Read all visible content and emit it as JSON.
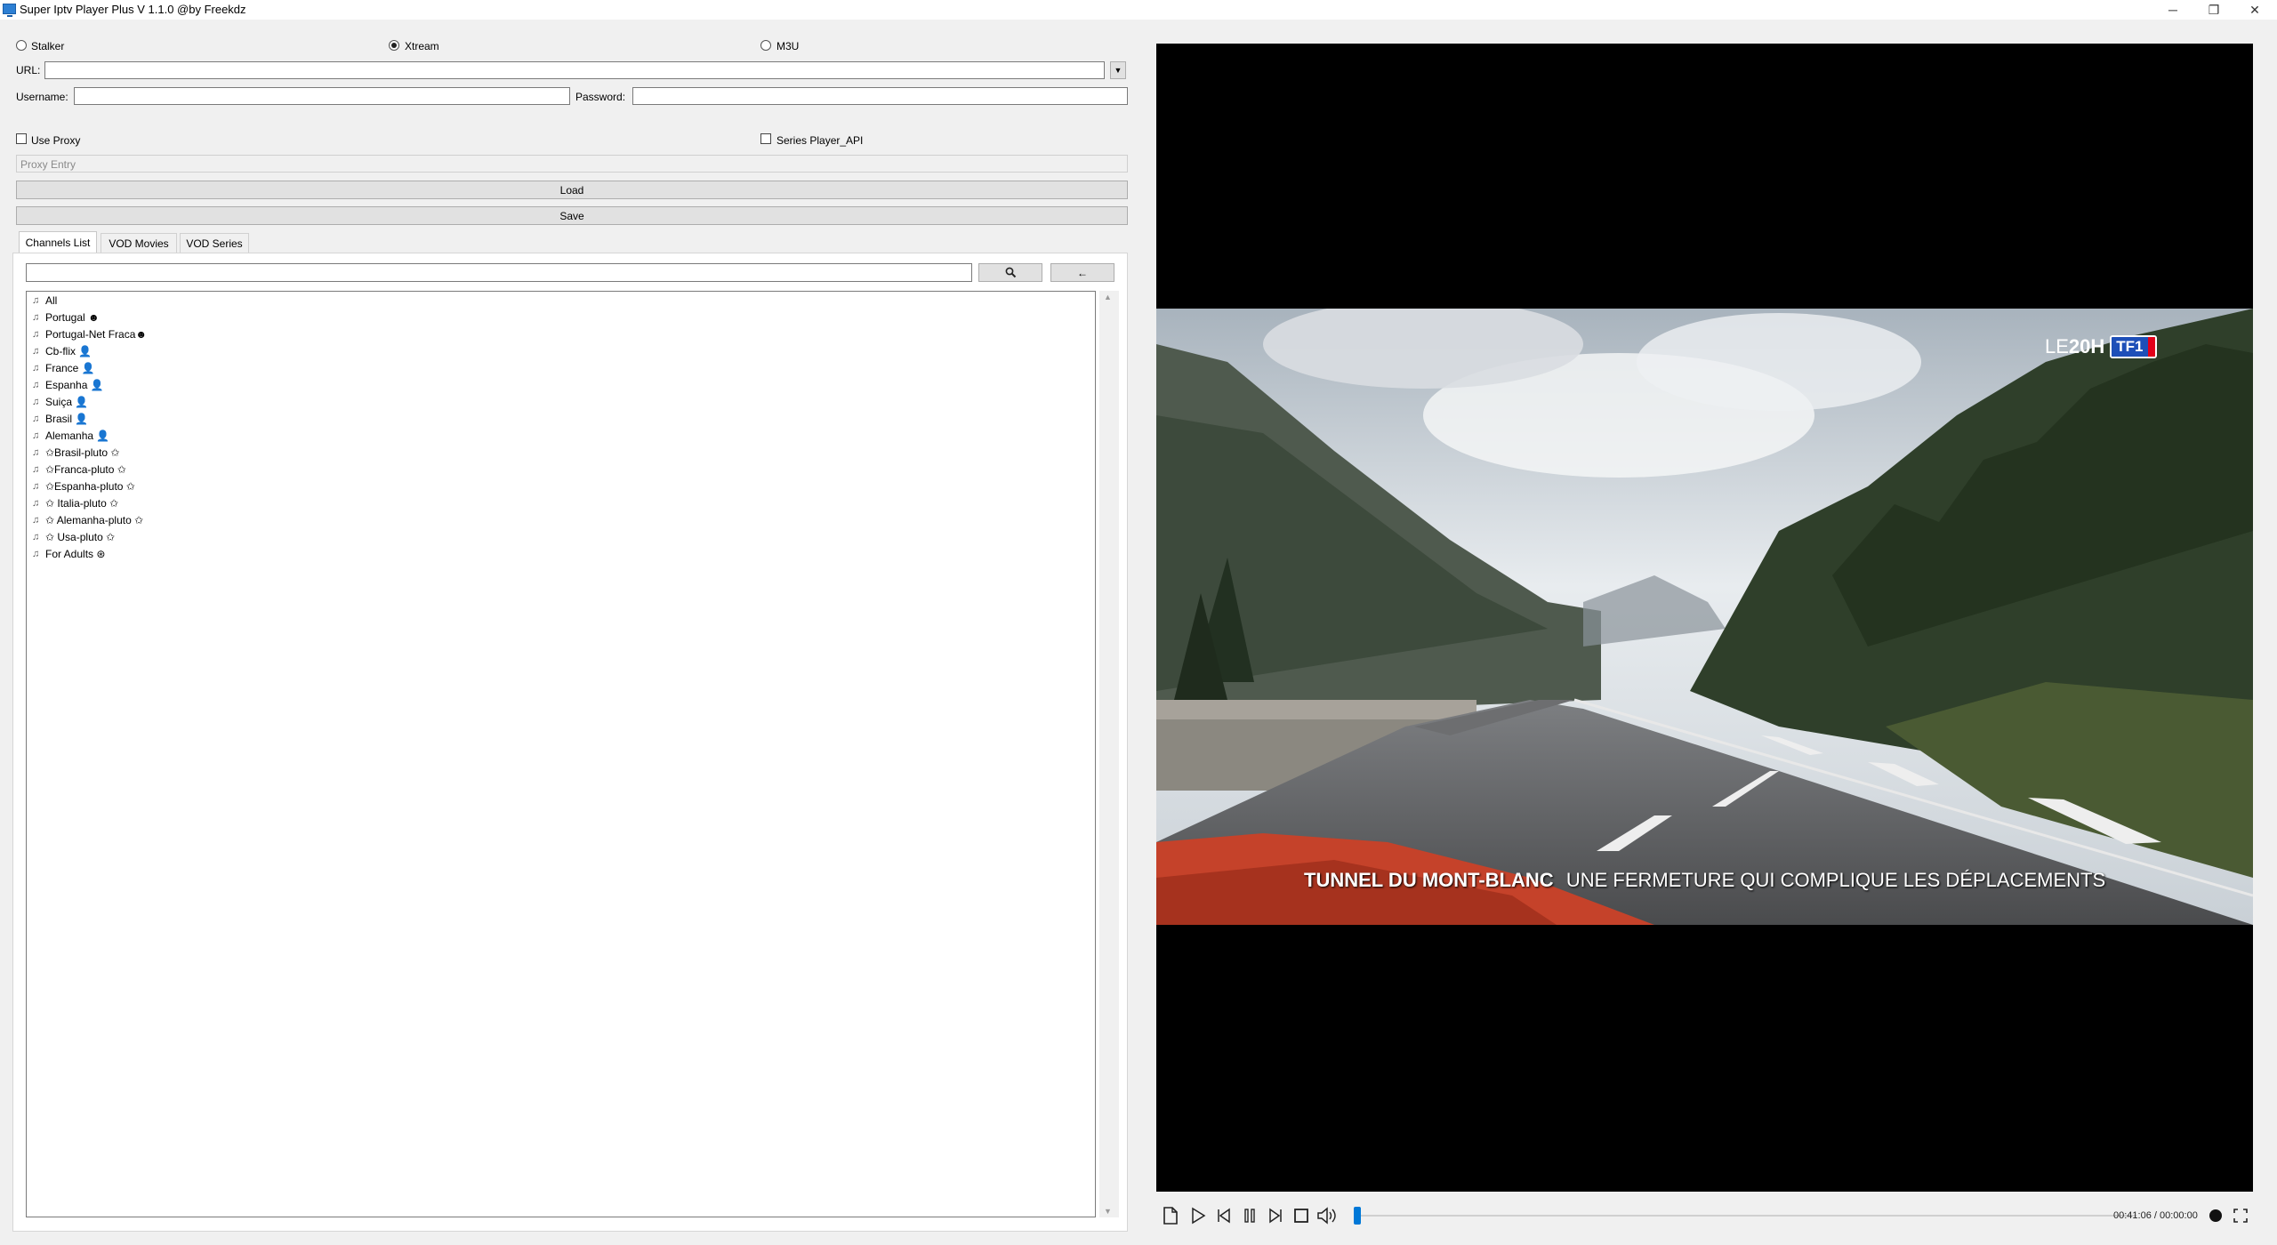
{
  "window": {
    "title": "Super Iptv Player Plus V 1.1.0 @by Freekdz",
    "minimize": "─",
    "restore": "❐",
    "close": "✕"
  },
  "source": {
    "options": [
      "Stalker",
      "Xtream",
      "M3U"
    ],
    "selected": "Xtream"
  },
  "form": {
    "url_label": "URL:",
    "url_value": "",
    "username_label": "Username:",
    "username_value": "",
    "password_label": "Password:",
    "password_value": "",
    "use_proxy_label": "Use Proxy",
    "series_api_label": "Series Player_API",
    "proxy_placeholder": "Proxy Entry",
    "load_label": "Load",
    "save_label": "Save"
  },
  "tabs": [
    "Channels List",
    "VOD Movies",
    "VOD Series"
  ],
  "active_tab": "Channels List",
  "search": {
    "value": "",
    "search_icon": "magnifier-icon",
    "back_label": "←"
  },
  "channels": [
    "All",
    "Portugal ☻",
    "Portugal-Net Fraca☻",
    "Cb-flix 👤",
    "France 👤",
    "Espanha 👤",
    "Suiça 👤",
    "Brasil 👤",
    "Alemanha 👤",
    "✩Brasil-pluto ✩",
    "✩Franca-pluto ✩",
    "✩Espanha-pluto ✩",
    "✩ Italia-pluto ✩",
    "✩ Alemanha-pluto ✩",
    "✩ Usa-pluto ✩",
    "For Adults ⊛"
  ],
  "video": {
    "logo_prefix": "LE",
    "logo_number": "20H",
    "logo_brand": "TF1",
    "caption_bold": "TUNNEL DU MONT-BLANC",
    "caption_text": "UNE FERMETURE QUI COMPLIQUE LES DÉPLACEMENTS"
  },
  "player_controls": {
    "time_display": "00:41:06 / 00:00:00",
    "seek_progress": 0.0,
    "icons": [
      "open-file-icon",
      "play-icon",
      "previous-icon",
      "pause-icon",
      "next-icon",
      "stop-icon",
      "volume-icon",
      "record-icon",
      "fullscreen-icon"
    ]
  },
  "colors": {
    "accent": "#0078d7",
    "tf1_blue": "#1d4fb8",
    "tf1_red": "#e2001a"
  }
}
